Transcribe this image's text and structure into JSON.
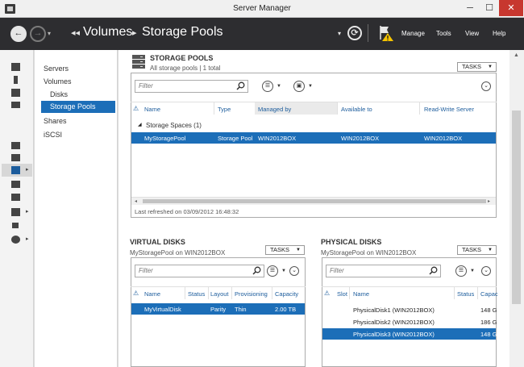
{
  "window": {
    "title": "Server Manager",
    "minimize": "─",
    "maximize": "☐",
    "close": "✕"
  },
  "header": {
    "back": "←",
    "forward": "→",
    "nav_dropdown": "▾",
    "breadcrumb_arrows": "◂◂",
    "breadcrumb": [
      "Volumes",
      "Storage Pools"
    ],
    "breadcrumb_sep": "▸",
    "refresh_dropdown": "▾",
    "refresh": "⟳",
    "menu": [
      "Manage",
      "Tools",
      "View",
      "Help"
    ]
  },
  "tree": {
    "items": [
      "Servers",
      "Volumes",
      "Disks",
      "Storage Pools",
      "Shares",
      "iSCSI"
    ],
    "selected": "Storage Pools"
  },
  "storage_pools": {
    "title": "STORAGE POOLS",
    "subtitle": "All storage pools | 1 total",
    "tasks": "TASKS",
    "filter_placeholder": "Filter",
    "columns": [
      "Name",
      "Type",
      "Managed by",
      "Available to",
      "Read-Write Server"
    ],
    "group": "Storage Spaces (1)",
    "rows": [
      {
        "name": "MyStoragePool",
        "type": "Storage Pool",
        "managed_by": "WIN2012BOX",
        "available_to": "WIN2012BOX",
        "rw_server": "WIN2012BOX"
      }
    ],
    "footer": "Last refreshed on 03/09/2012 16:48:32"
  },
  "virtual_disks": {
    "title": "VIRTUAL DISKS",
    "subtitle": "MyStoragePool on WIN2012BOX",
    "tasks": "TASKS",
    "filter_placeholder": "Filter",
    "columns": [
      "Name",
      "Status",
      "Layout",
      "Provisioning",
      "Capacity"
    ],
    "rows": [
      {
        "name": "MyVirtualDisk",
        "status": "",
        "layout": "Parity",
        "provisioning": "Thin",
        "capacity": "2.00 TB"
      }
    ]
  },
  "physical_disks": {
    "title": "PHYSICAL DISKS",
    "subtitle": "MyStoragePool on WIN2012BOX",
    "tasks": "TASKS",
    "filter_placeholder": "Filter",
    "columns": [
      "Slot",
      "Name",
      "Status",
      "Capac"
    ],
    "rows": [
      {
        "slot": "",
        "name": "PhysicalDisk1 (WIN2012BOX)",
        "status": "",
        "capacity": "148 G"
      },
      {
        "slot": "",
        "name": "PhysicalDisk2 (WIN2012BOX)",
        "status": "",
        "capacity": "186 G"
      },
      {
        "slot": "",
        "name": "PhysicalDisk3 (WIN2012BOX)",
        "status": "",
        "capacity": "148 G"
      }
    ],
    "selected_index": 2
  },
  "colors": {
    "header_bg": "#2d2d30",
    "selection": "#1c6eb8",
    "column_header": "#1c5c9c",
    "close_button": "#c7372f"
  }
}
